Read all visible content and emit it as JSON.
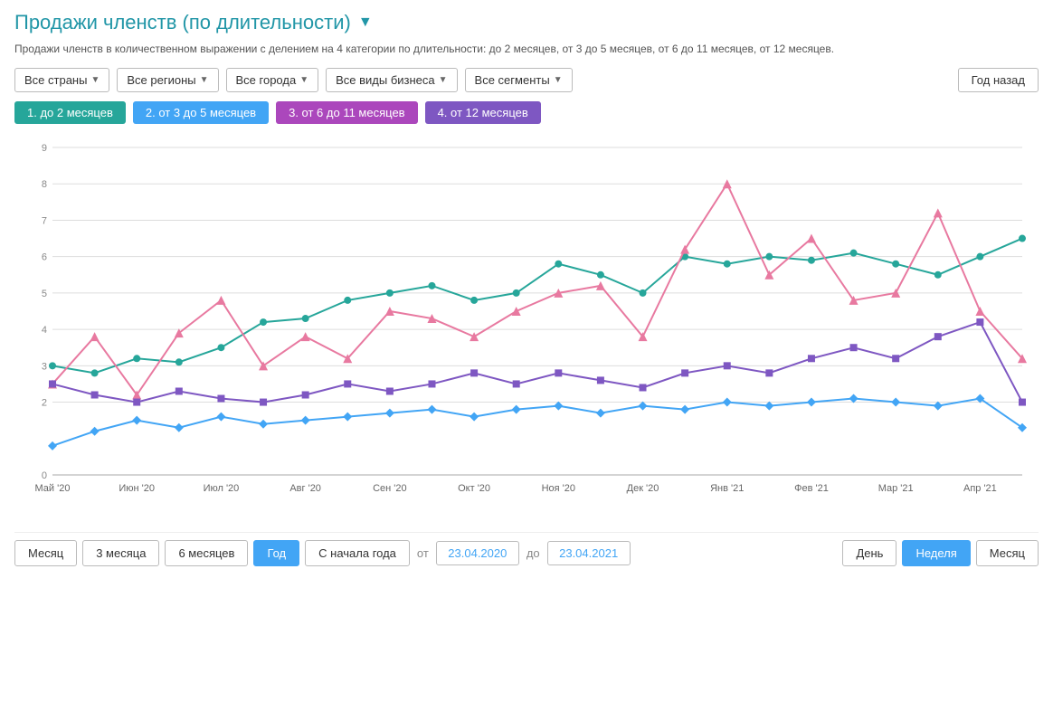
{
  "title": "Продажи членств (по длительности)",
  "subtitle": "Продажи членств в количественном выражении с делением на 4 категории по длительности: до 2 месяцев, от 3 до 5 месяцев, от 6 до 11 месяцев, от 12 месяцев.",
  "filters": {
    "countries": "Все страны",
    "regions": "Все регионы",
    "cities": "Все города",
    "business": "Все виды бизнеса",
    "segments": "Все сегменты",
    "period": "Год назад"
  },
  "legend": [
    {
      "id": 1,
      "label": "1. до 2 месяцев",
      "color": "#26a69a"
    },
    {
      "id": 2,
      "label": "2. от 3 до 5 месяцев",
      "color": "#42a5f5"
    },
    {
      "id": 3,
      "label": "3. от 6 до 11 месяцев",
      "color": "#ab47bc"
    },
    {
      "id": 4,
      "label": "4. от 12 месяцев",
      "color": "#7e57c2"
    }
  ],
  "xAxis": [
    "Май '20",
    "Июн '20",
    "Июл '20",
    "Авг '20",
    "Сен '20",
    "Окт '20",
    "Ноя '20",
    "Дек '20",
    "Янв '21",
    "Фев '21",
    "Мар '21",
    "Апр '21"
  ],
  "yAxis": [
    0,
    2,
    3,
    4,
    5,
    6,
    7,
    8,
    9
  ],
  "bottomControls": {
    "month": "Месяц",
    "threeMonth": "3 месяца",
    "sixMonth": "6 месяцев",
    "year": "Год",
    "ytd": "С начала года",
    "from": "от",
    "dateFrom": "23.04.2020",
    "to": "до",
    "dateTo": "23.04.2021",
    "day": "День",
    "week": "Неделя",
    "monthEnd": "Месяц"
  },
  "chart": {
    "green": [
      3.0,
      2.8,
      3.2,
      3.1,
      3.5,
      4.2,
      4.3,
      4.8,
      5.0,
      5.2,
      4.8,
      5.0,
      5.8,
      5.5,
      5.0,
      6.0,
      5.8,
      6.0,
      5.9,
      6.1,
      5.8,
      5.5,
      6.0,
      6.5
    ],
    "pink": [
      2.5,
      3.8,
      2.2,
      3.9,
      4.8,
      3.0,
      3.8,
      3.2,
      4.5,
      4.3,
      3.8,
      4.5,
      5.0,
      5.2,
      3.8,
      6.2,
      8.0,
      5.5,
      6.5,
      4.8,
      5.0,
      7.2,
      4.5,
      3.2
    ],
    "purple": [
      2.5,
      2.2,
      2.0,
      2.3,
      2.1,
      2.0,
      2.2,
      2.5,
      2.3,
      2.5,
      2.8,
      2.5,
      2.8,
      2.6,
      2.4,
      2.8,
      3.0,
      2.8,
      3.2,
      3.5,
      3.2,
      3.8,
      4.2,
      2.0
    ],
    "blue": [
      0.8,
      1.2,
      1.5,
      1.3,
      1.6,
      1.4,
      1.5,
      1.6,
      1.7,
      1.8,
      1.6,
      1.8,
      1.9,
      1.7,
      1.9,
      1.8,
      2.0,
      1.9,
      2.0,
      2.1,
      2.0,
      1.9,
      2.1,
      1.3
    ]
  }
}
